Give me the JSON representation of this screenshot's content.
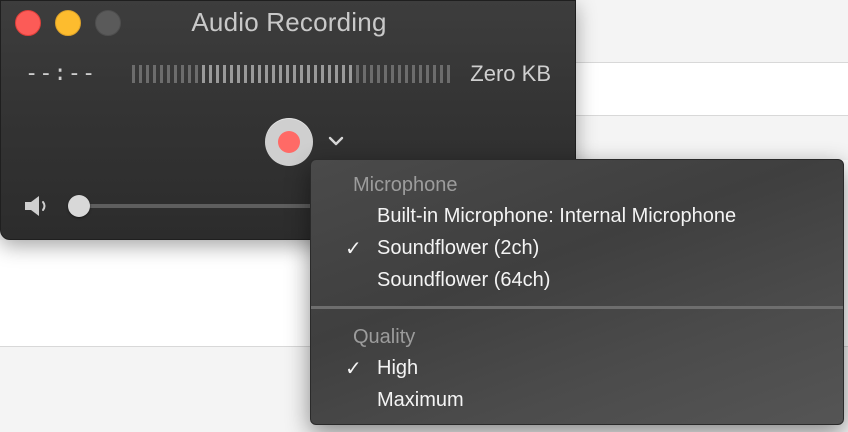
{
  "window": {
    "title": "Audio Recording",
    "elapsed_time": "--:--",
    "file_size": "Zero KB",
    "volume_level": 0.0
  },
  "colors": {
    "close": "#fc5b57",
    "minimize": "#fdbc2e",
    "record_dot": "#ff6a66"
  },
  "menu": {
    "sections": [
      {
        "header": "Microphone",
        "items": [
          {
            "label": "Built-in Microphone: Internal Microphone",
            "checked": false
          },
          {
            "label": "Soundflower (2ch)",
            "checked": true
          },
          {
            "label": "Soundflower (64ch)",
            "checked": false
          }
        ]
      },
      {
        "header": "Quality",
        "items": [
          {
            "label": "High",
            "checked": true
          },
          {
            "label": "Maximum",
            "checked": false
          }
        ]
      }
    ],
    "check_glyph": "✓"
  }
}
